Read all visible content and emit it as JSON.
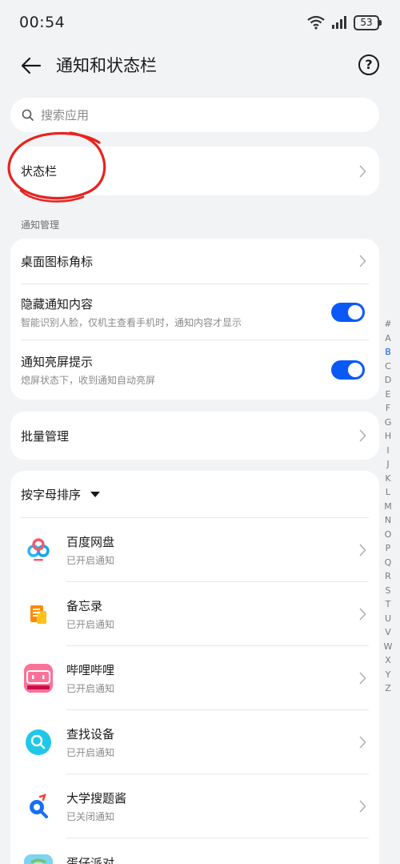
{
  "status": {
    "time": "00:54",
    "battery": "53"
  },
  "header": {
    "title": "通知和状态栏",
    "help": "?"
  },
  "search": {
    "placeholder": "搜索应用"
  },
  "status_bar_item": {
    "label": "状态栏"
  },
  "notification_section": {
    "label": "通知管理",
    "items": [
      {
        "title": "桌面图标角标",
        "subtitle": ""
      },
      {
        "title": "隐藏通知内容",
        "subtitle": "智能识别人脸，仅机主查看手机时，通知内容才显示",
        "toggle_on": true
      },
      {
        "title": "通知亮屏提示",
        "subtitle": "熄屏状态下，收到通知自动亮屏",
        "toggle_on": true
      }
    ]
  },
  "batch": {
    "label": "批量管理"
  },
  "sort": {
    "label": "按字母排序"
  },
  "apps": [
    {
      "name": "百度网盘",
      "status": "已开启通知"
    },
    {
      "name": "备忘录",
      "status": "已开启通知"
    },
    {
      "name": "哔哩哔哩",
      "status": "已开启通知"
    },
    {
      "name": "查找设备",
      "status": "已开启通知"
    },
    {
      "name": "大学搜题酱",
      "status": "已关闭通知"
    },
    {
      "name": "蛋仔派对",
      "status": ""
    }
  ],
  "index": [
    "#",
    "A",
    "B",
    "C",
    "D",
    "E",
    "F",
    "G",
    "H",
    "I",
    "J",
    "K",
    "L",
    "M",
    "N",
    "O",
    "P",
    "Q",
    "R",
    "S",
    "T",
    "U",
    "V",
    "W",
    "X",
    "Y",
    "Z"
  ],
  "index_active": "B",
  "colors": {
    "accent": "#0a59f7",
    "annotation": "#e8231f"
  }
}
